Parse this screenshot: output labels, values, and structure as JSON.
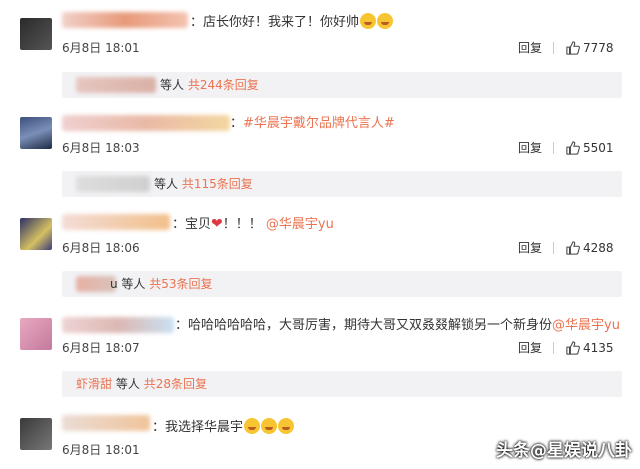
{
  "comments": [
    {
      "text": "：店长你好！我来了！你好帅",
      "date": "6月8日 18:01",
      "reply": "回复",
      "likes": "7778",
      "sub": {
        "prefix_text": "等人",
        "link": "共244条回复"
      }
    },
    {
      "text": "：",
      "topic": "#华晨宇戴尔品牌代言人#",
      "date": "6月8日 18:03",
      "reply": "回复",
      "likes": "5501",
      "sub": {
        "prefix_text": "等人",
        "link": "共115条回复"
      }
    },
    {
      "text": "：宝贝",
      "after_heart": "！！！",
      "mention": "@华晨宇yu",
      "date": "6月8日 18:06",
      "reply": "回复",
      "likes": "4288",
      "sub": {
        "prefix_text": "u 等人",
        "link": "共53条回复"
      }
    },
    {
      "text": "：哈哈哈哈哈哈，大哥厉害，期待大哥又双叒叕解锁另一个新身份",
      "mention": "@华晨宇yu",
      "date": "6月8日 18:07",
      "reply": "回复",
      "likes": "4135",
      "sub": {
        "name": "虾滑甜",
        "prefix_text": "等人",
        "link": "共28条回复"
      }
    },
    {
      "text": "：我选择华晨宇",
      "date": "6月8日 18:01"
    }
  ],
  "watermark": "头条@星娱说八卦",
  "colors": {
    "accent": "#eb7350",
    "subbox": "#f2f2f5"
  }
}
